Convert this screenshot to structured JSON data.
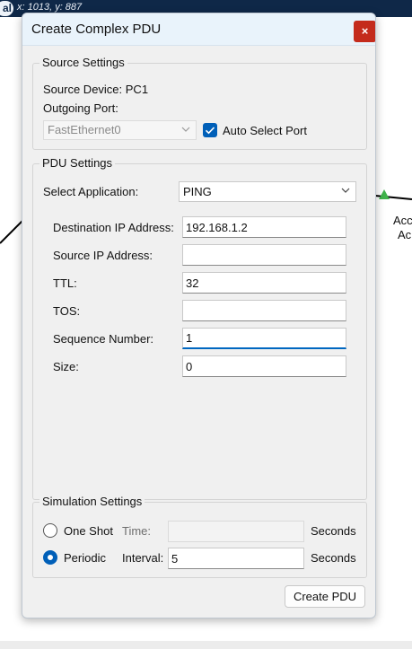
{
  "background": {
    "logo_text": "al",
    "coords": "x: 1013, y: 887",
    "canvas_label_1": "Acc",
    "canvas_label_2": "Ac"
  },
  "dialog": {
    "title": "Create Complex PDU",
    "close_glyph": "×"
  },
  "source_settings": {
    "group_title": "Source Settings",
    "source_device": "Source Device: PC1",
    "outgoing_port_label": "Outgoing Port:",
    "port_value": "FastEthernet0",
    "auto_select_label": "Auto Select Port",
    "auto_select_checked": true
  },
  "pdu_settings": {
    "group_title": "PDU Settings",
    "select_app_label": "Select Application:",
    "app_value": "PING",
    "fields": [
      {
        "label": "Destination IP Address:",
        "value": "192.168.1.2"
      },
      {
        "label": "Source IP Address:",
        "value": ""
      },
      {
        "label": "TTL:",
        "value": "32"
      },
      {
        "label": "TOS:",
        "value": ""
      },
      {
        "label": "Sequence Number:",
        "value": "1"
      },
      {
        "label": "Size:",
        "value": "0"
      }
    ]
  },
  "simulation_settings": {
    "group_title": "Simulation Settings",
    "one_shot_label": "One Shot",
    "time_label": "Time:",
    "time_value": "",
    "seconds_label_1": "Seconds",
    "periodic_label": "Periodic",
    "interval_label": "Interval:",
    "interval_value": "5",
    "seconds_label_2": "Seconds",
    "selected_mode": "Periodic"
  },
  "buttons": {
    "create_pdu": "Create PDU"
  },
  "colors": {
    "accent": "#005fb8",
    "close": "#c42b1c",
    "topbar": "#0f2848"
  }
}
